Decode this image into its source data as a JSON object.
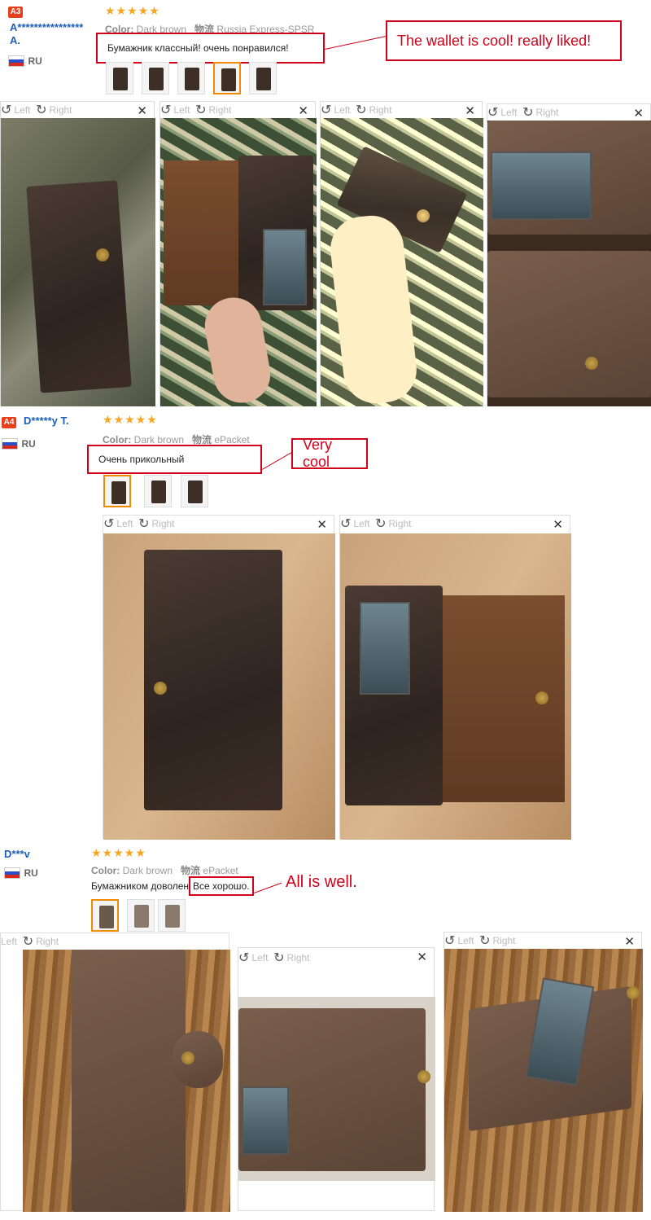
{
  "reviews": [
    {
      "badge": "A3",
      "name": "A****************",
      "name_line2": "A.",
      "country": "RU",
      "stars": "★★★★★",
      "color_label": "Color:",
      "color_value": "Dark brown",
      "shipping_label": "物流",
      "shipping_value": "Russia Express-SPSR",
      "comment": "Бумажник классный! очень понравился!",
      "translation": "The wallet is cool! really liked!"
    },
    {
      "badge": "A4",
      "name": "D*****y T.",
      "country": "RU",
      "stars": "★★★★★",
      "color_label": "Color:",
      "color_value": "Dark brown",
      "shipping_label": "物流",
      "shipping_value": "ePacket",
      "comment": "Очень прикольный",
      "translation": "Very cool"
    },
    {
      "name": "D***v",
      "country": "RU",
      "stars": "★★★★★",
      "color_label": "Color:",
      "color_value": "Dark brown",
      "shipping_label": "物流",
      "shipping_value": "ePacket",
      "comment_pre": "Бумажником доволен.",
      "comment": "Все хорошо.",
      "translation": "All is well."
    }
  ],
  "viewer": {
    "left_label": "Left",
    "right_label": "Right",
    "rotate_left_icon": "↺",
    "rotate_right_icon": "↻",
    "close_icon": "✕"
  }
}
